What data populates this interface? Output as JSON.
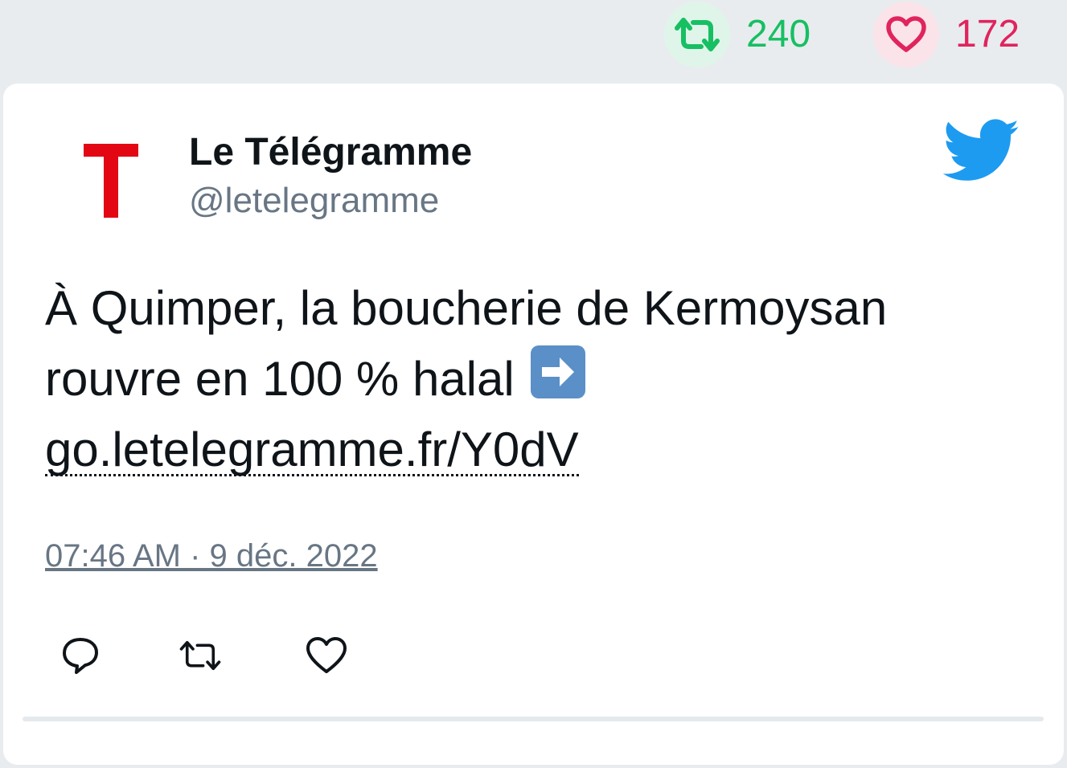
{
  "stats": {
    "retweets": "240",
    "likes": "172"
  },
  "author": {
    "avatar_letter": "T",
    "name": "Le Télégramme",
    "handle": "@letelegramme"
  },
  "tweet": {
    "text_line1": "À Quimper, la boucherie de Kermoysan",
    "text_line2": "rouvre en 100 % halal",
    "emoji": "arrow-right-emoji",
    "link": "go.letelegramme.fr/Y0dV",
    "timestamp": "07:46 AM · 9 déc. 2022"
  },
  "colors": {
    "retweet_green": "#17bf63",
    "like_red": "#e0245e",
    "twitter_blue": "#1d9bf0",
    "brand_red": "#e30613",
    "handle_gray": "#687684"
  },
  "icons": {
    "retweet_stat": "retweet-icon",
    "like_stat": "heart-icon",
    "logo": "twitter-bird-icon",
    "reply": "reply-icon",
    "retweet": "retweet-icon",
    "like": "heart-icon"
  }
}
